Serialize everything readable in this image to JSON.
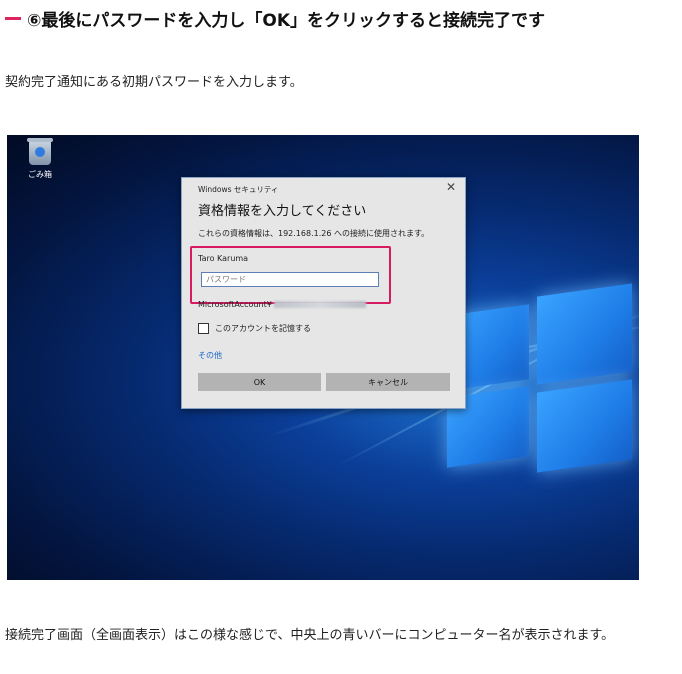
{
  "heading": "⑥最後にパスワードを入力し「OK」をクリックすると接続完了です",
  "intro": "契約完了通知にある初期パスワードを入力します。",
  "screenshot": {
    "desktop_icon_label": "ごみ箱",
    "dialog": {
      "window_title": "Windows セキュリティ",
      "close_glyph": "✕",
      "heading": "資格情報を入力してください",
      "message": "これらの資格情報は、192.168.1.26 への接続に使用されます。",
      "username": "Taro Karuma",
      "password_placeholder": "パスワード",
      "ms_account_prefix": "MicrosoftAccount¥",
      "remember_label": "このアカウントを記憶する",
      "more_link": "その他",
      "ok_button": "OK",
      "cancel_button": "キャンセル"
    },
    "colors": {
      "highlight": "#d81b60",
      "link": "#1a66c8"
    }
  },
  "caption": "接続完了画面（全画面表示）はこの様な感じで、中央上の青いバーにコンピューター名が表示されます。"
}
